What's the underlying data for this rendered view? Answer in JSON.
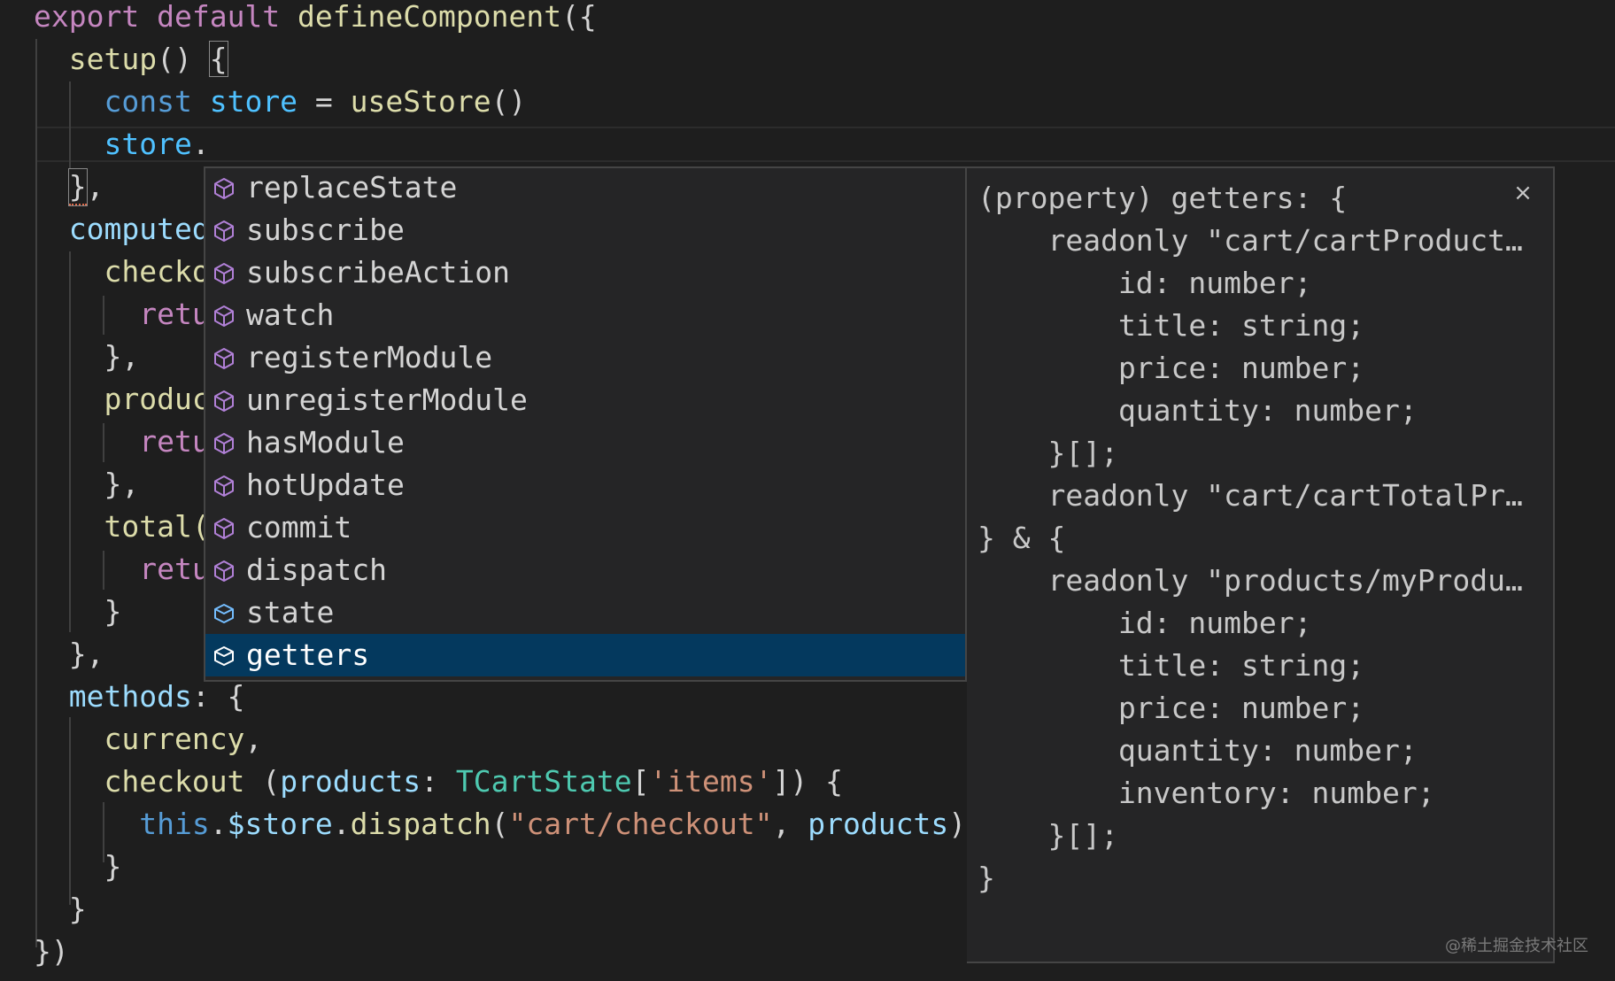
{
  "colors": {
    "background": "#1e1e1e",
    "widget_bg": "#252526",
    "selected_bg": "#04395e",
    "method_icon": "#b180d7",
    "field_icon": "#75beff"
  },
  "code": {
    "line1": {
      "t1": "export",
      "t2": " ",
      "t3": "default",
      "t4": " ",
      "t5": "defineComponent",
      "t6": "({"
    },
    "line2": {
      "t1": "  ",
      "t2": "setup",
      "t3": "() ",
      "t4": "{"
    },
    "line3": {
      "t1": "    ",
      "t2": "const",
      "t3": " ",
      "t4": "store",
      "t5": " = ",
      "t6": "useStore",
      "t7": "()"
    },
    "line4": {
      "t1": "    ",
      "t2": "store",
      "t3": "."
    },
    "line5": {
      "t1": "  ",
      "t2": "}",
      "t3": ","
    },
    "line6": {
      "t1": "  ",
      "t2": "computed"
    },
    "line7": {
      "t1": "    ",
      "t2": "checko"
    },
    "line8": {
      "t1": "      ",
      "t2": "retu"
    },
    "line9": {
      "t1": "    },"
    },
    "line10": {
      "t1": "    ",
      "t2": "produc"
    },
    "line11": {
      "t1": "      ",
      "t2": "retu"
    },
    "line12": {
      "t1": "    },"
    },
    "line13": {
      "t1": "    ",
      "t2": "total("
    },
    "line14": {
      "t1": "      ",
      "t2": "retu"
    },
    "line15": {
      "t1": "    }"
    },
    "line16": {
      "t1": "  },"
    },
    "line17": {
      "t1": "  ",
      "t2": "methods",
      "t3": ": {"
    },
    "line18": {
      "t1": "    ",
      "t2": "currency",
      "t3": ","
    },
    "line19": {
      "t1": "    ",
      "t2": "checkout",
      "t3": " (",
      "t4": "products",
      "t5": ": ",
      "t6": "TCartState",
      "t7": "[",
      "t8": "'items'",
      "t9": "]) {"
    },
    "line20": {
      "t1": "      ",
      "t2": "this",
      "t3": ".",
      "t4": "$store",
      "t5": ".",
      "t6": "dispatch",
      "t7": "(",
      "t8": "\"cart/checkout\"",
      "t9": ", ",
      "t10": "products",
      "t11": ")"
    },
    "line21": {
      "t1": "    }"
    },
    "line22": {
      "t1": "  }"
    },
    "line23": {
      "t1": "})"
    }
  },
  "suggestions": [
    {
      "label": "replaceState",
      "icon": "method-cube-icon"
    },
    {
      "label": "subscribe",
      "icon": "method-cube-icon"
    },
    {
      "label": "subscribeAction",
      "icon": "method-cube-icon"
    },
    {
      "label": "watch",
      "icon": "method-cube-icon"
    },
    {
      "label": "registerModule",
      "icon": "method-cube-icon"
    },
    {
      "label": "unregisterModule",
      "icon": "method-cube-icon"
    },
    {
      "label": "hasModule",
      "icon": "method-cube-icon"
    },
    {
      "label": "hotUpdate",
      "icon": "method-cube-icon"
    },
    {
      "label": "commit",
      "icon": "method-cube-icon"
    },
    {
      "label": "dispatch",
      "icon": "method-cube-icon"
    },
    {
      "label": "state",
      "icon": "field-cube-icon"
    },
    {
      "label": "getters",
      "icon": "field-cube-icon",
      "selected": true
    }
  ],
  "details": {
    "lines": [
      "(property) getters: {",
      "    readonly \"cart/cartProduct…",
      "        id: number;",
      "        title: string;",
      "        price: number;",
      "        quantity: number;",
      "    }[];",
      "    readonly \"cart/cartTotalPr…",
      "} & {",
      "    readonly \"products/myProdu…",
      "        id: number;",
      "        title: string;",
      "        price: number;",
      "        quantity: number;",
      "        inventory: number;",
      "    }[];",
      "}"
    ],
    "close_label": "×"
  },
  "watermark": "@稀土掘金技术社区"
}
